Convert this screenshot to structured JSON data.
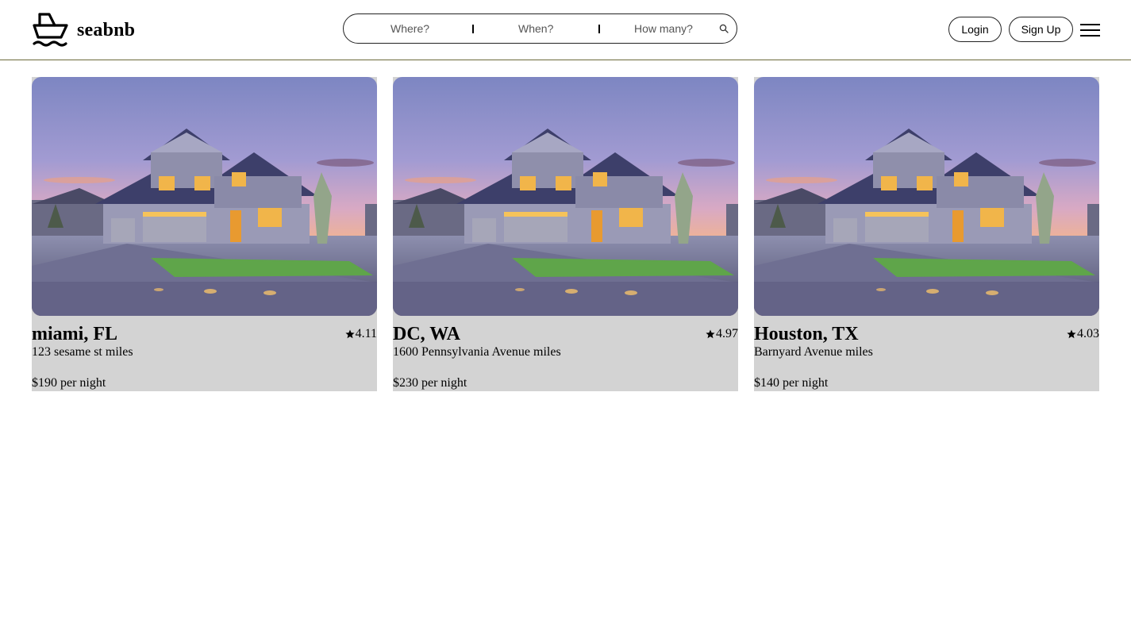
{
  "brand": {
    "name": "seabnb",
    "logo_icon": "ship-icon"
  },
  "search": {
    "where_label": "Where?",
    "when_label": "When?",
    "guests_label": "How many?",
    "icon": "search-icon"
  },
  "header": {
    "login_label": "Login",
    "signup_label": "Sign Up",
    "menu_icon": "hamburger-menu-icon"
  },
  "listings": [
    {
      "title": "miami, FL",
      "rating": "4.11",
      "address": "123 sesame st miles",
      "price": "$190 per night"
    },
    {
      "title": "DC, WA",
      "rating": "4.97",
      "address": "1600 Pennsylvania Avenue miles",
      "price": "$230 per night"
    },
    {
      "title": "Houston, TX",
      "rating": "4.03",
      "address": "Barnyard Avenue miles",
      "price": "$140 per night"
    }
  ],
  "colors": {
    "card_background": "#d3d3d3",
    "header_border": "#6b6a3a"
  }
}
